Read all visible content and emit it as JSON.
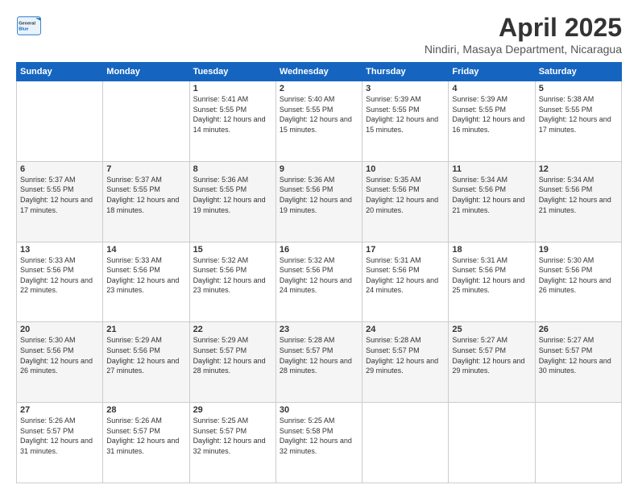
{
  "header": {
    "logo_general": "General",
    "logo_blue": "Blue",
    "main_title": "April 2025",
    "sub_title": "Nindiri, Masaya Department, Nicaragua"
  },
  "calendar": {
    "days_of_week": [
      "Sunday",
      "Monday",
      "Tuesday",
      "Wednesday",
      "Thursday",
      "Friday",
      "Saturday"
    ],
    "weeks": [
      [
        {
          "day": "",
          "info": ""
        },
        {
          "day": "",
          "info": ""
        },
        {
          "day": "1",
          "info": "Sunrise: 5:41 AM\nSunset: 5:55 PM\nDaylight: 12 hours\nand 14 minutes."
        },
        {
          "day": "2",
          "info": "Sunrise: 5:40 AM\nSunset: 5:55 PM\nDaylight: 12 hours\nand 15 minutes."
        },
        {
          "day": "3",
          "info": "Sunrise: 5:39 AM\nSunset: 5:55 PM\nDaylight: 12 hours\nand 15 minutes."
        },
        {
          "day": "4",
          "info": "Sunrise: 5:39 AM\nSunset: 5:55 PM\nDaylight: 12 hours\nand 16 minutes."
        },
        {
          "day": "5",
          "info": "Sunrise: 5:38 AM\nSunset: 5:55 PM\nDaylight: 12 hours\nand 17 minutes."
        }
      ],
      [
        {
          "day": "6",
          "info": "Sunrise: 5:37 AM\nSunset: 5:55 PM\nDaylight: 12 hours\nand 17 minutes."
        },
        {
          "day": "7",
          "info": "Sunrise: 5:37 AM\nSunset: 5:55 PM\nDaylight: 12 hours\nand 18 minutes."
        },
        {
          "day": "8",
          "info": "Sunrise: 5:36 AM\nSunset: 5:55 PM\nDaylight: 12 hours\nand 19 minutes."
        },
        {
          "day": "9",
          "info": "Sunrise: 5:36 AM\nSunset: 5:56 PM\nDaylight: 12 hours\nand 19 minutes."
        },
        {
          "day": "10",
          "info": "Sunrise: 5:35 AM\nSunset: 5:56 PM\nDaylight: 12 hours\nand 20 minutes."
        },
        {
          "day": "11",
          "info": "Sunrise: 5:34 AM\nSunset: 5:56 PM\nDaylight: 12 hours\nand 21 minutes."
        },
        {
          "day": "12",
          "info": "Sunrise: 5:34 AM\nSunset: 5:56 PM\nDaylight: 12 hours\nand 21 minutes."
        }
      ],
      [
        {
          "day": "13",
          "info": "Sunrise: 5:33 AM\nSunset: 5:56 PM\nDaylight: 12 hours\nand 22 minutes."
        },
        {
          "day": "14",
          "info": "Sunrise: 5:33 AM\nSunset: 5:56 PM\nDaylight: 12 hours\nand 23 minutes."
        },
        {
          "day": "15",
          "info": "Sunrise: 5:32 AM\nSunset: 5:56 PM\nDaylight: 12 hours\nand 23 minutes."
        },
        {
          "day": "16",
          "info": "Sunrise: 5:32 AM\nSunset: 5:56 PM\nDaylight: 12 hours\nand 24 minutes."
        },
        {
          "day": "17",
          "info": "Sunrise: 5:31 AM\nSunset: 5:56 PM\nDaylight: 12 hours\nand 24 minutes."
        },
        {
          "day": "18",
          "info": "Sunrise: 5:31 AM\nSunset: 5:56 PM\nDaylight: 12 hours\nand 25 minutes."
        },
        {
          "day": "19",
          "info": "Sunrise: 5:30 AM\nSunset: 5:56 PM\nDaylight: 12 hours\nand 26 minutes."
        }
      ],
      [
        {
          "day": "20",
          "info": "Sunrise: 5:30 AM\nSunset: 5:56 PM\nDaylight: 12 hours\nand 26 minutes."
        },
        {
          "day": "21",
          "info": "Sunrise: 5:29 AM\nSunset: 5:56 PM\nDaylight: 12 hours\nand 27 minutes."
        },
        {
          "day": "22",
          "info": "Sunrise: 5:29 AM\nSunset: 5:57 PM\nDaylight: 12 hours\nand 28 minutes."
        },
        {
          "day": "23",
          "info": "Sunrise: 5:28 AM\nSunset: 5:57 PM\nDaylight: 12 hours\nand 28 minutes."
        },
        {
          "day": "24",
          "info": "Sunrise: 5:28 AM\nSunset: 5:57 PM\nDaylight: 12 hours\nand 29 minutes."
        },
        {
          "day": "25",
          "info": "Sunrise: 5:27 AM\nSunset: 5:57 PM\nDaylight: 12 hours\nand 29 minutes."
        },
        {
          "day": "26",
          "info": "Sunrise: 5:27 AM\nSunset: 5:57 PM\nDaylight: 12 hours\nand 30 minutes."
        }
      ],
      [
        {
          "day": "27",
          "info": "Sunrise: 5:26 AM\nSunset: 5:57 PM\nDaylight: 12 hours\nand 31 minutes."
        },
        {
          "day": "28",
          "info": "Sunrise: 5:26 AM\nSunset: 5:57 PM\nDaylight: 12 hours\nand 31 minutes."
        },
        {
          "day": "29",
          "info": "Sunrise: 5:25 AM\nSunset: 5:57 PM\nDaylight: 12 hours\nand 32 minutes."
        },
        {
          "day": "30",
          "info": "Sunrise: 5:25 AM\nSunset: 5:58 PM\nDaylight: 12 hours\nand 32 minutes."
        },
        {
          "day": "",
          "info": ""
        },
        {
          "day": "",
          "info": ""
        },
        {
          "day": "",
          "info": ""
        }
      ]
    ]
  }
}
